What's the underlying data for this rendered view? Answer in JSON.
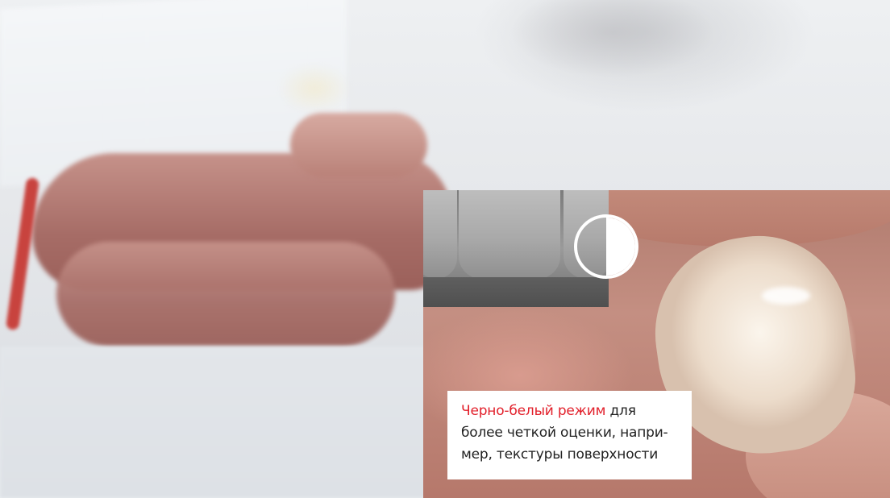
{
  "caption": {
    "highlight": "Черно-белый режим",
    "line1_rest": " для",
    "line2": "более четкой оценки, напри-",
    "line3": "мер, текстуры поверхности"
  },
  "colors": {
    "accent": "#e2202b",
    "text": "#222222",
    "caption_bg": "#ffffff"
  },
  "icons": {
    "mode_toggle": "half-circle-contrast-icon"
  }
}
